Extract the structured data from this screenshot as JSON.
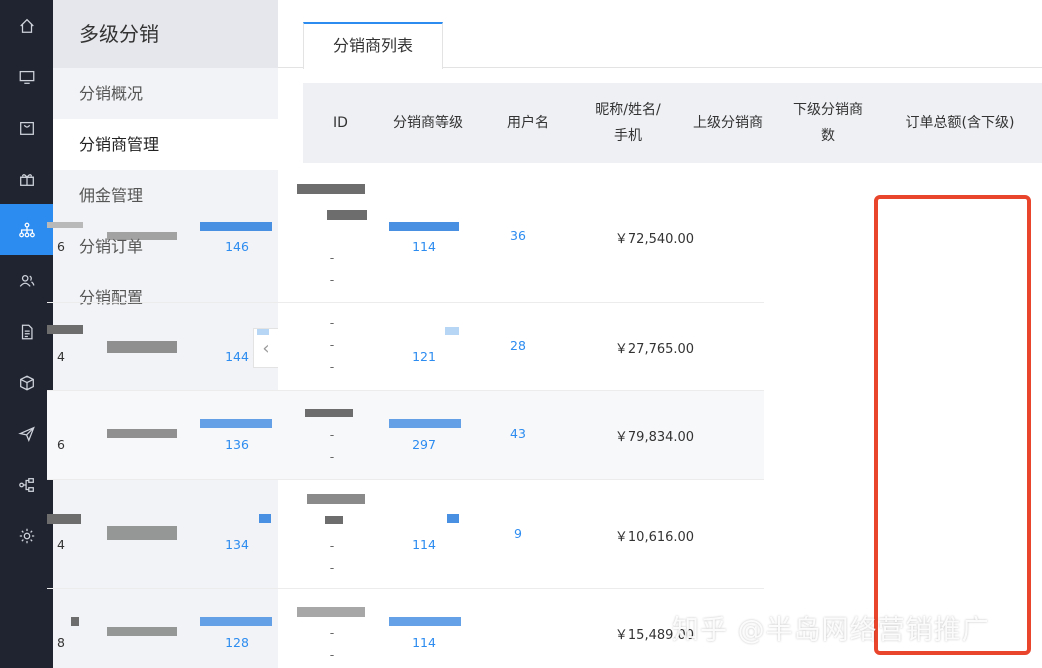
{
  "rail": {
    "items": [
      {
        "icon": "home-icon"
      },
      {
        "icon": "monitor-icon"
      },
      {
        "icon": "bag-icon"
      },
      {
        "icon": "gift-icon"
      },
      {
        "icon": "network-icon",
        "active": true
      },
      {
        "icon": "users-icon"
      },
      {
        "icon": "document-icon"
      },
      {
        "icon": "box-icon"
      },
      {
        "icon": "send-icon"
      },
      {
        "icon": "flow-icon"
      },
      {
        "icon": "gear-icon"
      }
    ]
  },
  "sidebar": {
    "title": "多级分销",
    "items": [
      {
        "label": "分销概况"
      },
      {
        "label": "分销商管理",
        "active": true
      },
      {
        "label": "佣金管理"
      },
      {
        "label": "分销订单"
      },
      {
        "label": "分销配置"
      }
    ],
    "collapse_glyph": "‹"
  },
  "tabs": [
    {
      "label": "分销商列表"
    }
  ],
  "table": {
    "headers": [
      "ID",
      "分销商等级",
      "用户名",
      "昵称/姓名/手机",
      "上级分销商",
      "下级分销商数",
      "订单总额(含下级)"
    ],
    "header_lines": {
      "nickname": [
        "昵称/姓名/",
        "手机"
      ],
      "subordinates": [
        "下级分销商",
        "数"
      ]
    },
    "rows": [
      {
        "id": "6",
        "username": "146",
        "superior": "114",
        "subordinates": "36",
        "total": "￥72,540.00",
        "nickname_lines": [
          "-",
          "-"
        ]
      },
      {
        "id": "4",
        "username": "144",
        "superior": "121",
        "subordinates": "28",
        "total": "￥27,765.00",
        "nickname_lines": [
          "-",
          "-",
          "-"
        ]
      },
      {
        "id": "6",
        "username": "136",
        "superior": "297",
        "subordinates": "43",
        "total": "￥79,834.00",
        "nickname_lines": [
          "-",
          "-"
        ]
      },
      {
        "id": "4",
        "username": "134",
        "superior": "114",
        "subordinates": "9",
        "total": "￥10,616.00",
        "nickname_lines": [
          "-",
          "-"
        ]
      },
      {
        "id": "8",
        "username": "128",
        "superior": "114",
        "subordinates": "",
        "total": "￥15,489.00",
        "nickname_lines": [
          "-",
          "-"
        ]
      }
    ]
  },
  "watermark": "知乎 @半岛网络营销推广",
  "colors": {
    "accent": "#2d8cf0",
    "highlight": "#e8452c",
    "rail_bg": "#1f2430"
  }
}
